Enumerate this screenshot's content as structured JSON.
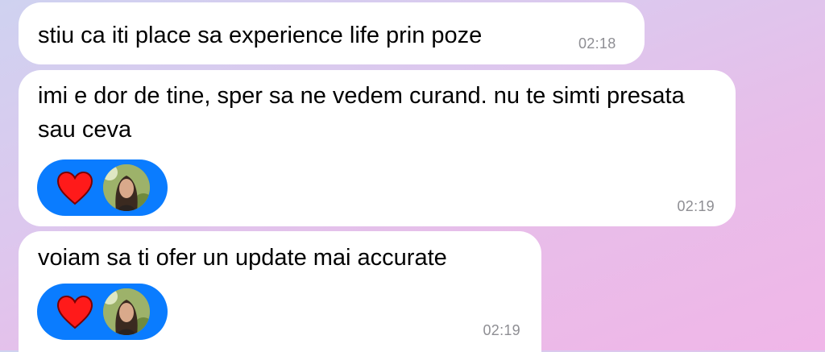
{
  "messages": [
    {
      "text": "stiu ca iti place sa experience life prin poze",
      "time": "02:18"
    },
    {
      "text": "imi e dor de tine, sper sa ne vedem curand. nu te simti presata sau ceva",
      "time": "02:19",
      "reaction": {
        "icon": "heart-icon",
        "color": "#ff1a1a"
      }
    },
    {
      "text": "voiam sa ti ofer un update mai accurate",
      "time": "02:19",
      "reaction": {
        "icon": "heart-icon",
        "color": "#ff1a1a"
      }
    }
  ],
  "colors": {
    "bubble": "#ffffff",
    "reaction_pill": "#0a7cff",
    "timestamp": "#8e8e93"
  }
}
